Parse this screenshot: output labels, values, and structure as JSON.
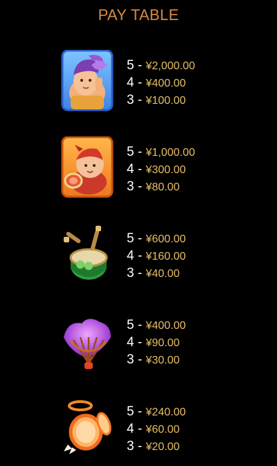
{
  "title": "PAY TABLE",
  "colors": {
    "title": "#d98a44",
    "count": "#ffffff",
    "amount": "#e8bf63",
    "background": "#000000"
  },
  "symbols": [
    {
      "icon": "purple-hair-boy-icon",
      "pays": [
        {
          "count": "5",
          "sep": " - ",
          "amount": "¥2,000.00"
        },
        {
          "count": "4",
          "sep": " - ",
          "amount": "¥400.00"
        },
        {
          "count": "3",
          "sep": " - ",
          "amount": "¥100.00"
        }
      ]
    },
    {
      "icon": "drummer-boy-icon",
      "pays": [
        {
          "count": "5",
          "sep": " - ",
          "amount": "¥1,000.00"
        },
        {
          "count": "4",
          "sep": " - ",
          "amount": "¥300.00"
        },
        {
          "count": "3",
          "sep": " - ",
          "amount": "¥80.00"
        }
      ]
    },
    {
      "icon": "green-drum-icon",
      "pays": [
        {
          "count": "5",
          "sep": " - ",
          "amount": "¥600.00"
        },
        {
          "count": "4",
          "sep": " - ",
          "amount": "¥160.00"
        },
        {
          "count": "3",
          "sep": " - ",
          "amount": "¥40.00"
        }
      ]
    },
    {
      "icon": "purple-fan-icon",
      "pays": [
        {
          "count": "5",
          "sep": " - ",
          "amount": "¥400.00"
        },
        {
          "count": "4",
          "sep": " - ",
          "amount": "¥90.00"
        },
        {
          "count": "3",
          "sep": " - ",
          "amount": "¥30.00"
        }
      ]
    },
    {
      "icon": "cymbal-mirror-icon",
      "pays": [
        {
          "count": "5",
          "sep": " - ",
          "amount": "¥240.00"
        },
        {
          "count": "4",
          "sep": " - ",
          "amount": "¥60.00"
        },
        {
          "count": "3",
          "sep": " - ",
          "amount": "¥20.00"
        }
      ]
    }
  ]
}
